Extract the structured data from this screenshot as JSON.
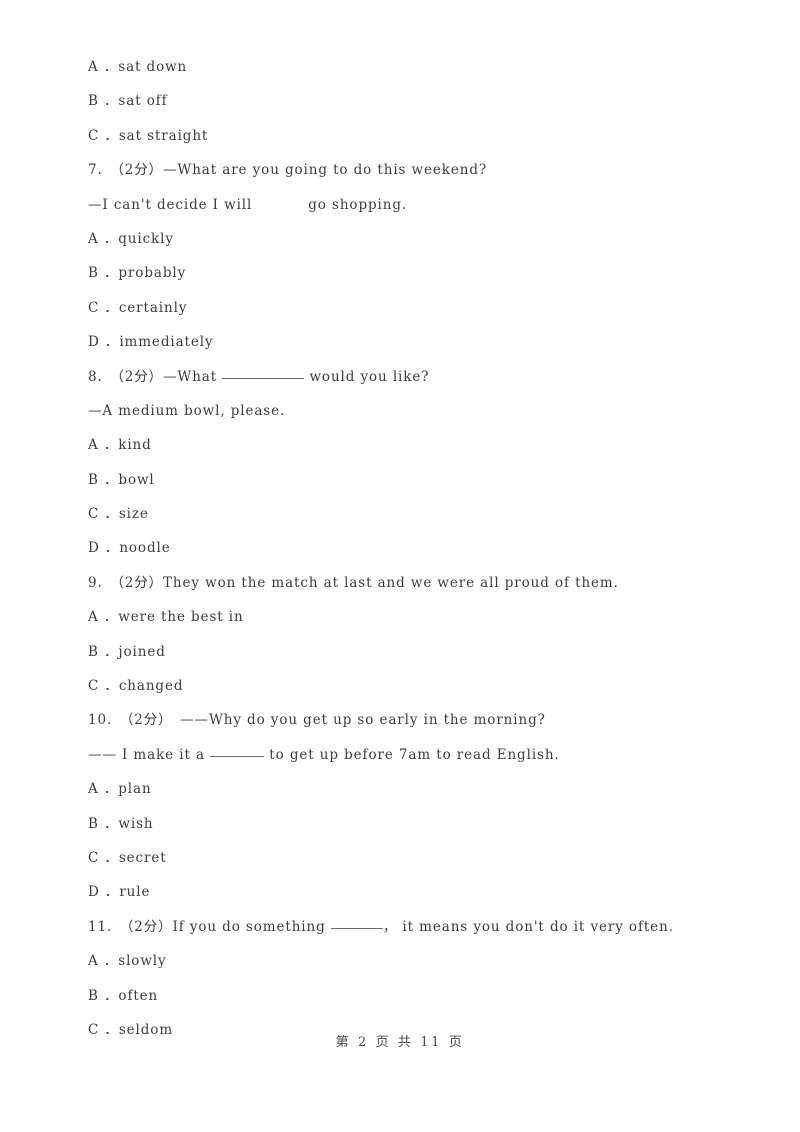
{
  "document": {
    "page_footer": "第 2 页 共 11 页",
    "page_number": "2",
    "total_pages": "11"
  },
  "carryover_options": [
    {
      "label": "A ．sat down"
    },
    {
      "label": "B ．sat off"
    },
    {
      "label": "C ．sat straight"
    }
  ],
  "questions": [
    {
      "number": "7.",
      "marks": "（2分）",
      "stem": "7.　（2分）—What are you going to do this weekend?",
      "stem_second_pre": "—I can't decide I will",
      "stem_second_post": "go shopping.",
      "blank_style": "space",
      "options": [
        {
          "label": "A ．quickly"
        },
        {
          "label": "B ．probably"
        },
        {
          "label": "C ．certainly"
        },
        {
          "label": "D ．immediately"
        }
      ]
    },
    {
      "number": "8.",
      "marks": "（2分）",
      "stem_pre": "8.　（2分）—What ",
      "stem_post": " would you like?",
      "stem_second": "—A medium bowl, please.",
      "blank_style": "underline-long",
      "options": [
        {
          "label": "A ．kind"
        },
        {
          "label": "B ．bowl"
        },
        {
          "label": "C ．size"
        },
        {
          "label": "D ．noodle"
        }
      ]
    },
    {
      "number": "9.",
      "marks": "（2分）",
      "stem": "9.　（2分）They won the match at last and we were all proud of them.",
      "options": [
        {
          "label": "A ．were the best in"
        },
        {
          "label": "B ．joined"
        },
        {
          "label": "C ．changed"
        }
      ]
    },
    {
      "number": "10.",
      "marks": "（2分）",
      "stem": "10.　（2分）　——Why do you get up so early in the morning?",
      "stem_second_pre": "—— I make it a ",
      "stem_second_post": " to get up before 7am to read English.",
      "blank_style": "underline-mid",
      "options": [
        {
          "label": "A ．plan"
        },
        {
          "label": "B ．wish"
        },
        {
          "label": "C ．secret"
        },
        {
          "label": "D ．rule"
        }
      ]
    },
    {
      "number": "11.",
      "marks": "（2分）",
      "stem_pre": "11.　（2分）If you do something ",
      "stem_post": "， it means you don't do it very often.",
      "blank_style": "underline-short",
      "options": [
        {
          "label": "A ．slowly"
        },
        {
          "label": "B ．often"
        },
        {
          "label": "C ．seldom"
        }
      ]
    }
  ]
}
